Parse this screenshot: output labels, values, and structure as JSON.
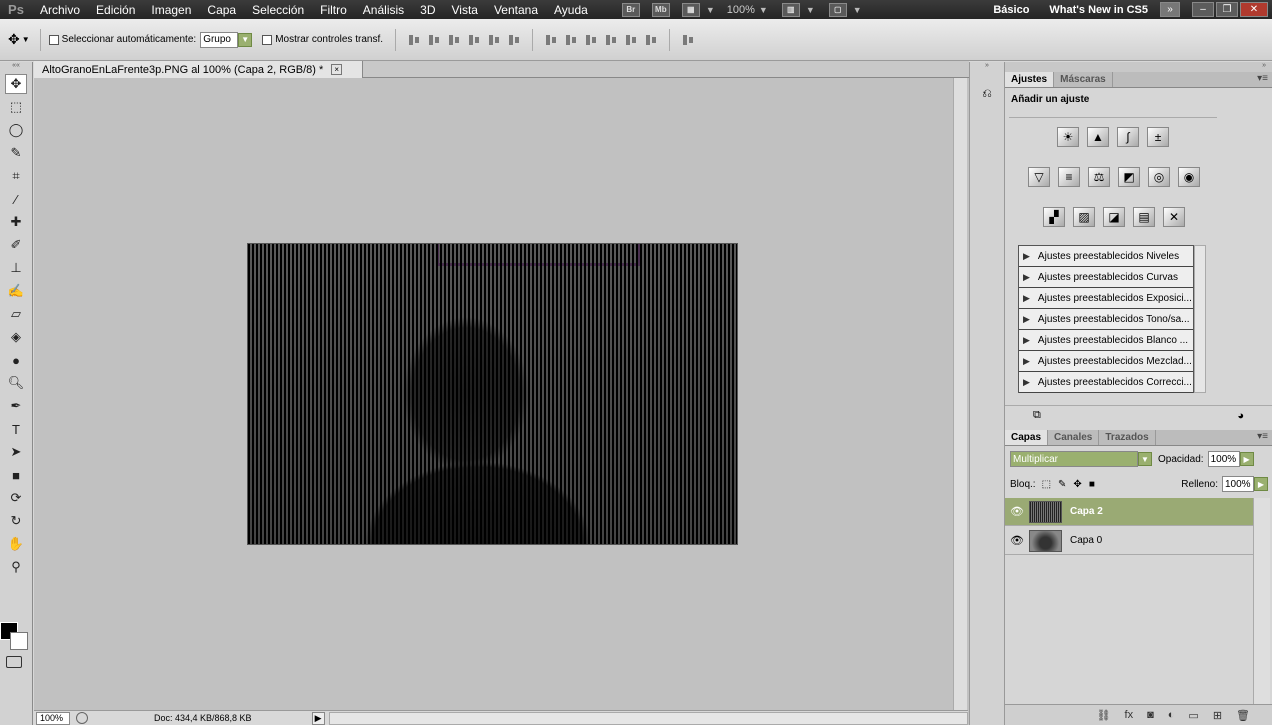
{
  "menubar": {
    "logo": "Ps",
    "items": [
      "Archivo",
      "Edición",
      "Imagen",
      "Capa",
      "Selección",
      "Filtro",
      "Análisis",
      "3D",
      "Vista",
      "Ventana",
      "Ayuda"
    ],
    "bridge_label": "Br",
    "minibridge_label": "Mb",
    "zoom": "100%",
    "workspace": "Básico",
    "whats_new": "What's New in CS5",
    "expand_glyph": "»"
  },
  "options": {
    "auto_select_label": "Seleccionar automáticamente:",
    "auto_select_value": "Grupo",
    "show_transform_label": "Mostrar controles transf."
  },
  "document": {
    "tab_title": "AltoGranoEnLaFrente3p.PNG al 100% (Capa 2, RGB/8) *",
    "close_glyph": "×"
  },
  "status": {
    "zoom": "100%",
    "doc_info": "Doc: 434,4 KB/868,8 KB"
  },
  "adjustments": {
    "tabs": [
      "Ajustes",
      "Máscaras"
    ],
    "heading": "Añadir un ajuste",
    "presets": [
      "Ajustes preestablecidos Niveles",
      "Ajustes preestablecidos Curvas",
      "Ajustes preestablecidos Exposici...",
      "Ajustes preestablecidos Tono/sa...",
      "Ajustes preestablecidos Blanco ...",
      "Ajustes preestablecidos Mezclad...",
      "Ajustes preestablecidos Correcci..."
    ]
  },
  "layers": {
    "tabs": [
      "Capas",
      "Canales",
      "Trazados"
    ],
    "blend_mode": "Multiplicar",
    "opacity_label": "Opacidad:",
    "opacity_value": "100%",
    "lock_label": "Bloq.:",
    "fill_label": "Relleno:",
    "fill_value": "100%",
    "items": [
      {
        "name": "Capa 2",
        "selected": true
      },
      {
        "name": "Capa 0",
        "selected": false
      }
    ]
  },
  "colors": {
    "selected_layer": "#9aaa74",
    "accent_green": "#9ab06f"
  }
}
